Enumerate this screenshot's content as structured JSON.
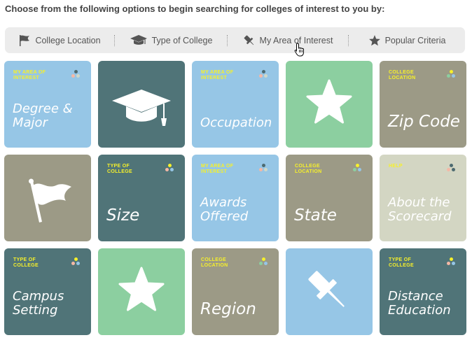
{
  "heading": "Choose from the following options to begin searching for colleges of interest to you by:",
  "nav": [
    {
      "label": "College Location",
      "icon": "flag-icon"
    },
    {
      "label": "Type of College",
      "icon": "graduation-cap-icon"
    },
    {
      "label": "My Area of Interest",
      "icon": "pushpin-icon"
    },
    {
      "label": "Popular Criteria",
      "icon": "star-icon"
    }
  ],
  "colors": {
    "blue": "#96c6e6",
    "teal": "#507478",
    "green": "#8ccfa0",
    "taupe": "#9c9a86",
    "light": "#d3d6c3",
    "category": "#f7f12a"
  },
  "tiles": [
    {
      "category": "MY AREA OF INTEREST",
      "title": "Degree & Major"
    },
    {
      "icon": "graduation-cap-icon"
    },
    {
      "category": "MY AREA OF INTEREST",
      "title": "Occupation"
    },
    {
      "icon": "star-icon"
    },
    {
      "category": "COLLEGE LOCATION",
      "title": "Zip Code"
    },
    {
      "icon": "flag-icon"
    },
    {
      "category": "TYPE OF COLLEGE",
      "title": "Size"
    },
    {
      "category": "MY AREA OF INTEREST",
      "title": "Awards Offered"
    },
    {
      "category": "COLLEGE LOCATION",
      "title": "State"
    },
    {
      "category": "HELP",
      "title": "About the Scorecard"
    },
    {
      "category": "TYPE OF COLLEGE",
      "title": "Campus Setting"
    },
    {
      "icon": "star-icon"
    },
    {
      "category": "COLLEGE LOCATION",
      "title": "Region"
    },
    {
      "icon": "pushpin-icon"
    },
    {
      "category": "TYPE OF COLLEGE",
      "title": "Distance Education"
    }
  ]
}
